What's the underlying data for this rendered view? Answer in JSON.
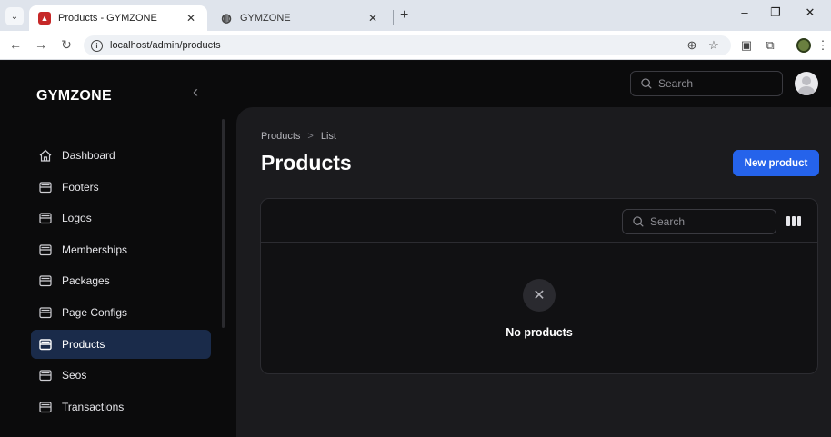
{
  "browser": {
    "tabs": [
      {
        "title": "Products - GYMZONE",
        "favicon": "gym-favicon",
        "active": true
      },
      {
        "title": "GYMZONE",
        "favicon": "globe-icon",
        "active": false
      }
    ],
    "new_tab": "+",
    "url": "localhost/admin/products",
    "window_controls": [
      "–",
      "❐",
      "✕"
    ]
  },
  "sidebar": {
    "brand": "GYMZONE",
    "collapse_icon": "chevron-left-icon",
    "items": [
      {
        "label": "Dashboard",
        "icon": "home-icon",
        "active": false
      },
      {
        "label": "Footers",
        "icon": "inbox-icon",
        "active": false
      },
      {
        "label": "Logos",
        "icon": "inbox-icon",
        "active": false
      },
      {
        "label": "Memberships",
        "icon": "inbox-icon",
        "active": false
      },
      {
        "label": "Packages",
        "icon": "inbox-icon",
        "active": false
      },
      {
        "label": "Page Configs",
        "icon": "inbox-icon",
        "active": false
      },
      {
        "label": "Products",
        "icon": "inbox-icon",
        "active": true
      },
      {
        "label": "Seos",
        "icon": "inbox-icon",
        "active": false
      },
      {
        "label": "Transactions",
        "icon": "inbox-icon",
        "active": false
      }
    ]
  },
  "topbar": {
    "search_placeholder": "Search"
  },
  "main": {
    "breadcrumb": [
      "Products",
      "List"
    ],
    "breadcrumb_separator": ">",
    "title": "Products",
    "new_button": "New product",
    "table": {
      "search_placeholder": "Search",
      "empty_icon": "x-icon",
      "empty_text": "No products"
    }
  },
  "colors": {
    "accent": "#2563eb",
    "active_nav": "#1a2b4a",
    "background": "#0b0b0c",
    "panel": "#1b1b1e"
  }
}
